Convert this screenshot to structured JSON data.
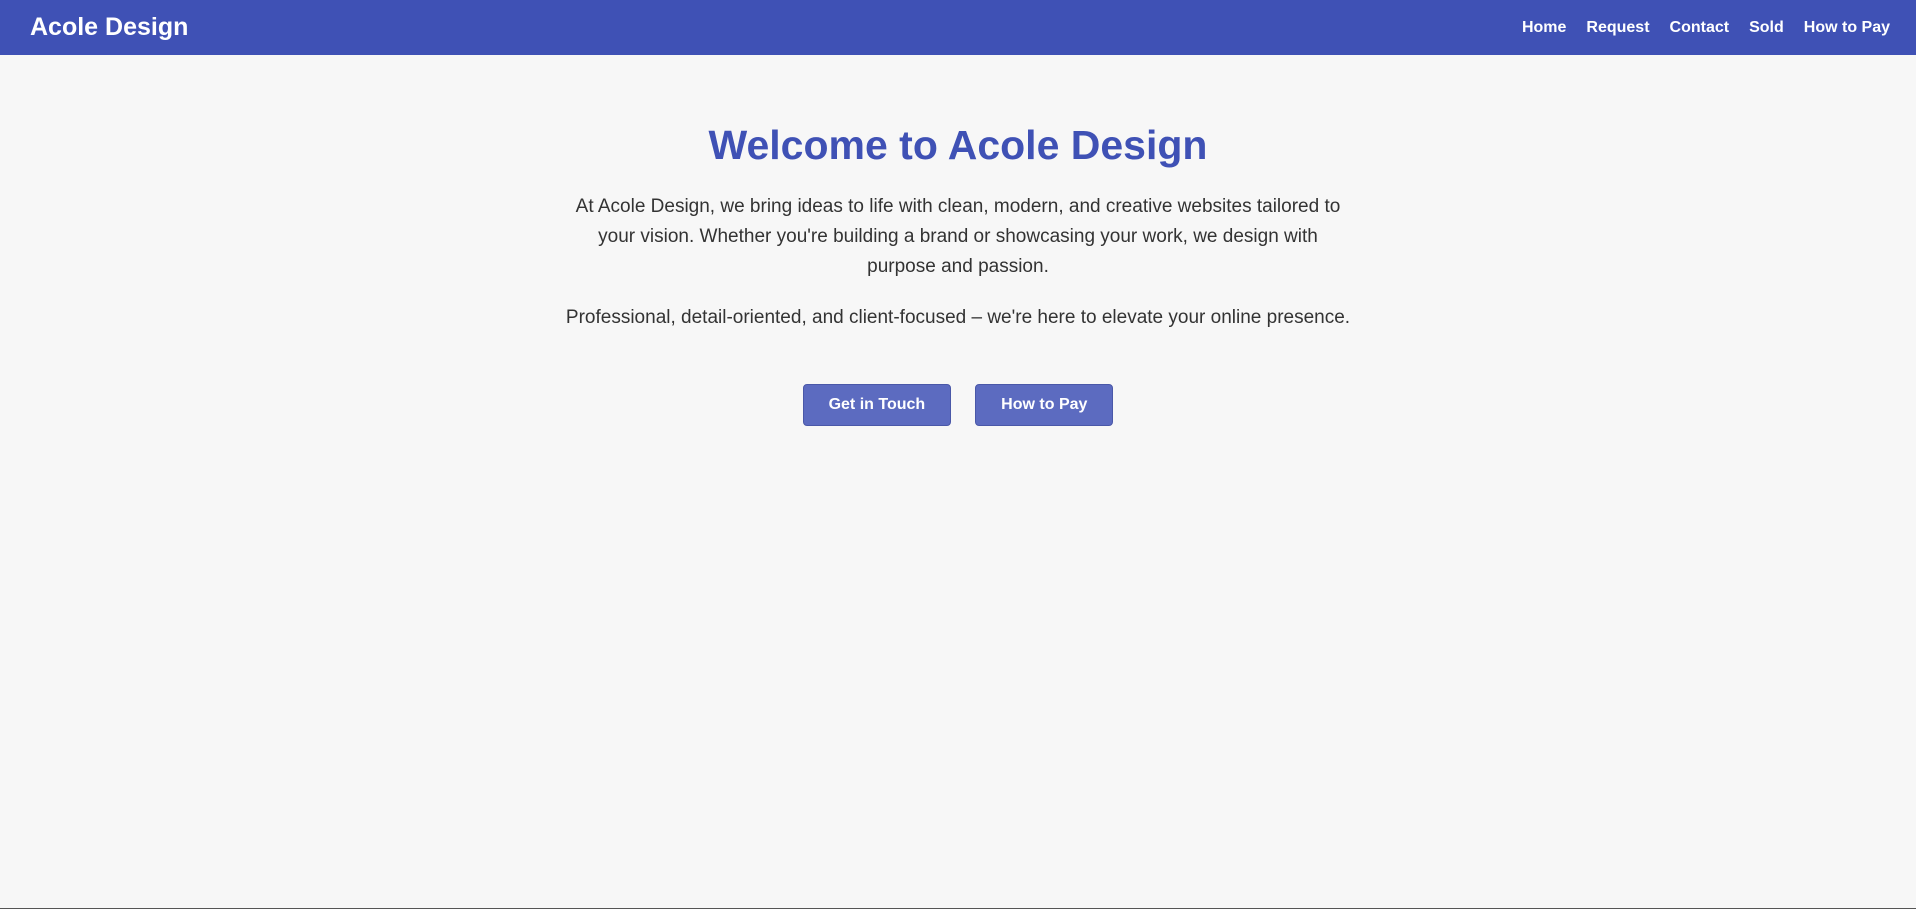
{
  "navbar": {
    "brand": "Acole Design",
    "links": [
      {
        "label": "Home"
      },
      {
        "label": "Request"
      },
      {
        "label": "Contact"
      },
      {
        "label": "Sold"
      },
      {
        "label": "How to Pay"
      }
    ]
  },
  "hero": {
    "title": "Welcome to Acole Design",
    "paragraph_1": "At Acole Design, we bring ideas to life with clean, modern, and creative websites tailored to your vision. Whether you're building a brand or showcasing your work, we design with purpose and passion.",
    "paragraph_2": "Professional, detail-oriented, and client-focused – we're here to elevate your online presence.",
    "buttons": {
      "get_in_touch": "Get in Touch",
      "how_to_pay": "How to Pay"
    }
  },
  "colors": {
    "navbar_bg": "#3f51b5",
    "title_color": "#3f51b5",
    "button_bg": "#5c6bc0",
    "page_bg": "#f7f7f7"
  }
}
